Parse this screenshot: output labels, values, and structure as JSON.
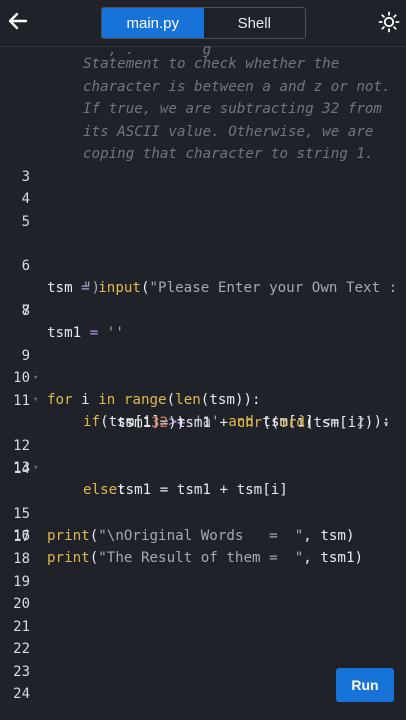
{
  "header": {
    "tabs": [
      {
        "label": "main.py",
        "active": true
      },
      {
        "label": "Shell",
        "active": false
      }
    ]
  },
  "comment_lines": [
    "   , .        g",
    "Statement to check whether the",
    "character is between a and z or not.",
    "If true, we are subtracting 32 from",
    "its ASCII value. Otherwise, we are",
    "coping that character to string 1."
  ],
  "line_numbers": [
    "3",
    "4",
    "5",
    "6",
    "7",
    "8",
    "9",
    "10",
    "11",
    "12",
    "13",
    "14",
    "15",
    "16",
    "17",
    "18",
    "19",
    "20",
    "21",
    "22",
    "23",
    "24"
  ],
  "code": {
    "l6a_var": "tsm",
    "l6a_eq": " = ",
    "l6a_fn": "input",
    "l6a_open": "(",
    "l6a_str": "\"Please Enter your Own Text :",
    "l6b_str": "\")",
    "l7_var": "tsm1",
    "l7_eq": " = ",
    "l7_str": "''",
    "l9_kw1": "for",
    "l9_mid": " i ",
    "l9_kw2": "in",
    "l9_sp": " ",
    "l9_fn": "range",
    "l9_o1": "(",
    "l9_fn2": "len",
    "l9_rest": "(tsm)):",
    "l10_kw": "if",
    "l10_a": "(tsm[i] ",
    "l10_op1": ">=",
    "l10_s1": " 'a' ",
    "l10_kw2": "and",
    "l10_b": " tsm[i] ",
    "l10_op2": "<=",
    "l10_s2": " 'z'",
    "l10_c": "):",
    "l11_a": "tsm1 = tsm1 + ",
    "l11_fn": "chr",
    "l11_b": "((",
    "l11_fn2": "ord",
    "l11_c": "(tsm[i]) -",
    "l11b_num": "32",
    "l11b_c": "))",
    "l12_kw": "else",
    "l12_c": ":",
    "l13_a": "tsm1 = tsm1 + tsm[i]",
    "l15_fn": "print",
    "l15_o": "(",
    "l15_str": "\"\\nOriginal Words   =  \"",
    "l15_rest": ", tsm)",
    "l16_fn": "print",
    "l16_o": "(",
    "l16_str": "\"The Result of them =  \"",
    "l16_rest": ", tsm1)"
  },
  "run_button": {
    "label": "Run"
  },
  "colors": {
    "accent": "#1873d9",
    "background": "#1f2329",
    "keyword": "#e0b84c",
    "number": "#e07c5c",
    "comment": "#6f7682"
  }
}
